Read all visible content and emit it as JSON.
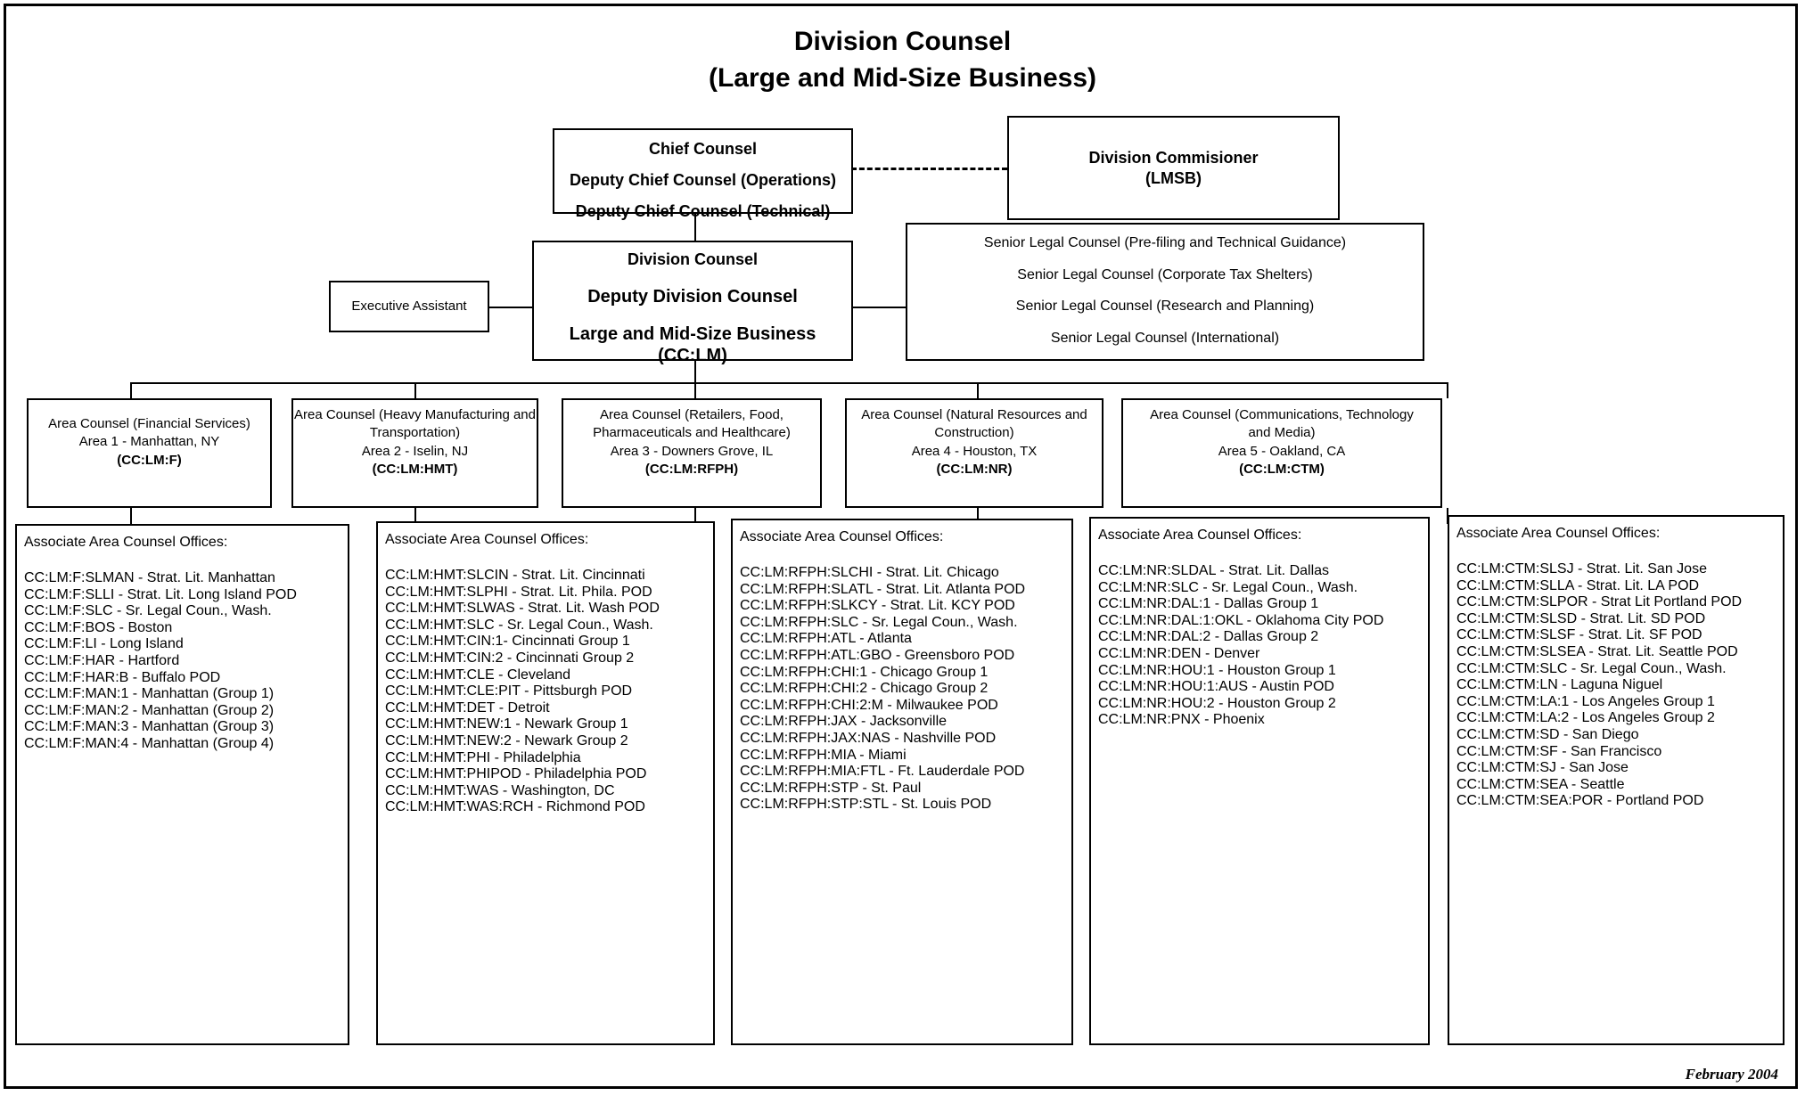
{
  "title": {
    "line1": "Division Counsel",
    "line2": "(Large and Mid-Size Business)"
  },
  "chief_counsel_box": {
    "line1": "Chief Counsel",
    "line2": "Deputy Chief Counsel (Operations)",
    "line3": "Deputy Chief Counsel (Technical)"
  },
  "division_commissioner_box": {
    "line1": "Division Commisioner",
    "line2": "(LMSB)"
  },
  "division_counsel_box": {
    "line1": "Division Counsel",
    "line2": "Deputy Division Counsel",
    "line3": "Large and Mid-Size Business",
    "line4": "(CC:LM)"
  },
  "executive_assistant_box": {
    "label": "Executive Assistant"
  },
  "senior_legal_counsel_box": {
    "items": [
      "Senior Legal Counsel (Pre-filing and Technical Guidance)",
      "Senior Legal Counsel (Corporate Tax Shelters)",
      "Senior Legal Counsel (Research and Planning)",
      "Senior Legal Counsel (International)"
    ]
  },
  "areas": [
    {
      "name_lines": [
        "Area Counsel (Financial Services)"
      ],
      "location": "Area 1 - Manhattan, NY",
      "code": "(CC:LM:F)",
      "offices_heading": "Associate Area Counsel Offices:",
      "offices": [
        "CC:LM:F:SLMAN - Strat. Lit. Manhattan",
        "CC:LM:F:SLLI - Strat. Lit. Long Island POD",
        "CC:LM:F:SLC - Sr. Legal Coun., Wash.",
        "CC:LM:F:BOS - Boston",
        "CC:LM:F:LI - Long Island",
        "CC:LM:F:HAR - Hartford",
        "CC:LM:F:HAR:B - Buffalo POD",
        "CC:LM:F:MAN:1 - Manhattan (Group 1)",
        "CC:LM:F:MAN:2 - Manhattan (Group 2)",
        "CC:LM:F:MAN:3 - Manhattan (Group 3)",
        "CC:LM:F:MAN:4 - Manhattan (Group 4)"
      ]
    },
    {
      "name_lines": [
        "Area Counsel (Heavy Manufacturing and",
        "Transportation)"
      ],
      "location": "Area 2 - Iselin, NJ",
      "code": "(CC:LM:HMT)",
      "offices_heading": "Associate Area Counsel Offices:",
      "offices": [
        "CC:LM:HMT:SLCIN - Strat. Lit. Cincinnati",
        "CC:LM:HMT:SLPHI - Strat. Lit. Phila. POD",
        "CC:LM:HMT:SLWAS - Strat. Lit. Wash POD",
        "CC:LM:HMT:SLC - Sr. Legal Coun., Wash.",
        "CC:LM:HMT:CIN:1- Cincinnati Group 1",
        "CC:LM:HMT:CIN:2 - Cincinnati Group 2",
        "CC:LM:HMT:CLE - Cleveland",
        "CC:LM:HMT:CLE:PIT - Pittsburgh POD",
        "CC:LM:HMT:DET - Detroit",
        "CC:LM:HMT:NEW:1 - Newark Group 1",
        "CC:LM:HMT:NEW:2 - Newark Group 2",
        "CC:LM:HMT:PHI - Philadelphia",
        "CC:LM:HMT:PHIPOD - Philadelphia POD",
        "CC:LM:HMT:WAS - Washington, DC",
        "CC:LM:HMT:WAS:RCH - Richmond POD"
      ]
    },
    {
      "name_lines": [
        "Area Counsel (Retailers, Food,",
        "Pharmaceuticals and Healthcare)"
      ],
      "location": "Area 3 - Downers Grove, IL",
      "code": "(CC:LM:RFPH)",
      "offices_heading": "Associate Area Counsel Offices:",
      "offices": [
        "CC:LM:RFPH:SLCHI - Strat. Lit. Chicago",
        "CC:LM:RFPH:SLATL - Strat. Lit. Atlanta POD",
        "CC:LM:RFPH:SLKCY - Strat. Lit. KCY POD",
        "CC:LM:RFPH:SLC - Sr. Legal Coun., Wash.",
        "CC:LM:RFPH:ATL - Atlanta",
        "CC:LM:RFPH:ATL:GBO - Greensboro POD",
        "CC:LM:RFPH:CHI:1 - Chicago Group 1",
        "CC:LM:RFPH:CHI:2 - Chicago Group 2",
        "CC:LM:RFPH:CHI:2:M - Milwaukee POD",
        "CC:LM:RFPH:JAX - Jacksonville",
        "CC:LM:RFPH:JAX:NAS - Nashville POD",
        "CC:LM:RFPH:MIA - Miami",
        "CC:LM:RFPH:MIA:FTL - Ft. Lauderdale POD",
        "CC:LM:RFPH:STP - St. Paul",
        "CC:LM:RFPH:STP:STL - St. Louis POD"
      ]
    },
    {
      "name_lines": [
        "Area Counsel (Natural Resources and",
        "Construction)"
      ],
      "location": "Area 4 - Houston, TX",
      "code": "(CC:LM:NR)",
      "offices_heading": "Associate Area Counsel Offices:",
      "offices": [
        "CC:LM:NR:SLDAL - Strat. Lit. Dallas",
        "CC:LM:NR:SLC - Sr. Legal Coun., Wash.",
        "CC:LM:NR:DAL:1 - Dallas Group 1",
        "CC:LM:NR:DAL:1:OKL - Oklahoma City POD",
        "CC:LM:NR:DAL:2 - Dallas Group 2",
        "CC:LM:NR:DEN - Denver",
        "CC:LM:NR:HOU:1 - Houston Group 1",
        "CC:LM:NR:HOU:1:AUS - Austin POD",
        "CC:LM:NR:HOU:2 - Houston Group 2",
        "CC:LM:NR:PNX - Phoenix"
      ]
    },
    {
      "name_lines": [
        "Area Counsel (Communications, Technology",
        "and Media)"
      ],
      "location": "Area 5 - Oakland, CA",
      "code": "(CC:LM:CTM)",
      "offices_heading": "Associate Area Counsel Offices:",
      "offices": [
        "CC:LM:CTM:SLSJ - Strat. Lit. San Jose",
        "CC:LM:CTM:SLLA - Strat. Lit. LA POD",
        "CC:LM:CTM:SLPOR - Strat Lit Portland POD",
        "CC:LM:CTM:SLSD - Strat. Lit. SD POD",
        "CC:LM:CTM:SLSF - Strat. Lit. SF POD",
        "CC:LM:CTM:SLSEA - Strat. Lit. Seattle POD",
        "CC:LM:CTM:SLC - Sr. Legal Coun., Wash.",
        "CC:LM:CTM:LN - Laguna Niguel",
        "CC:LM:CTM:LA:1 - Los Angeles Group 1",
        "CC:LM:CTM:LA:2 - Los Angeles Group 2",
        "CC:LM:CTM:SD - San Diego",
        "CC:LM:CTM:SF - San Francisco",
        "CC:LM:CTM:SJ - San Jose",
        "CC:LM:CTM:SEA - Seattle",
        "CC:LM:CTM:SEA:POR - Portland POD"
      ]
    }
  ],
  "footer": {
    "date": "February 2004"
  }
}
